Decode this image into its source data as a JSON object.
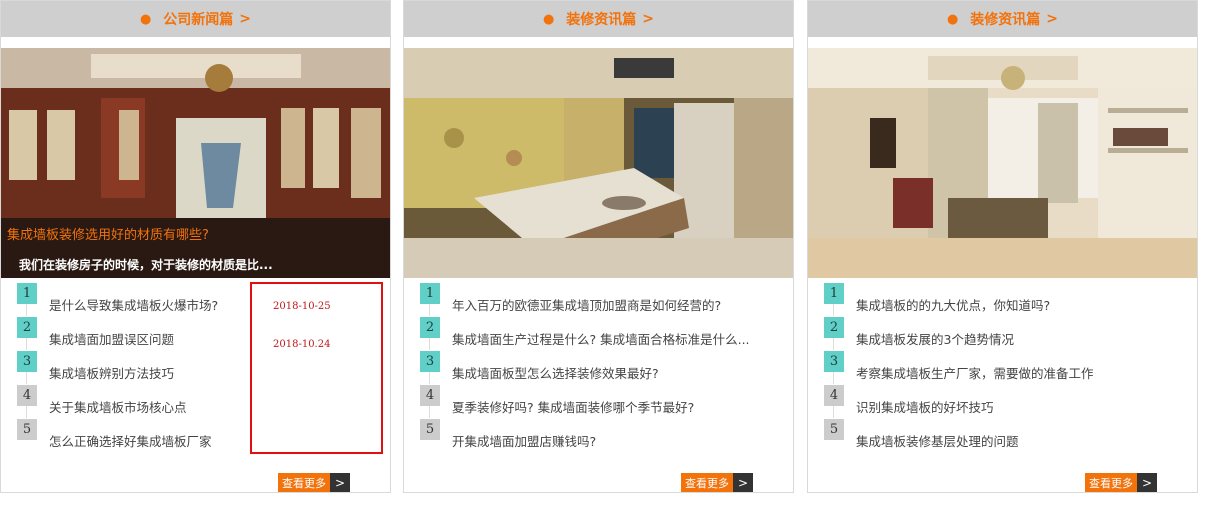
{
  "panels": [
    {
      "header": {
        "dot": "●",
        "title": "公司新闻篇",
        "arrow": ">"
      },
      "hero_title": "集成墙板装修选用好的材质有哪些?",
      "hero_desc": "我们在装修房子的时候，对于装修的材质是比...",
      "items": [
        {
          "num": "1",
          "text": "是什么导致集成墙板火爆市场?"
        },
        {
          "num": "2",
          "text": "集成墙面加盟误区问题"
        },
        {
          "num": "3",
          "text": "集成墙板辨别方法技巧"
        },
        {
          "num": "4",
          "text": "关于集成墙板市场核心点"
        },
        {
          "num": "5",
          "text": "怎么正确选择好集成墙板厂家"
        }
      ],
      "more_label": "查看更多",
      "more_arrow": ">"
    },
    {
      "header": {
        "dot": "●",
        "title": "装修资讯篇",
        "arrow": ">"
      },
      "items": [
        {
          "num": "1",
          "text": "年入百万的欧德亚集成墙顶加盟商是如何经营的?"
        },
        {
          "num": "2",
          "text": "集成墙面生产过程是什么? 集成墙面合格标准是什么..."
        },
        {
          "num": "3",
          "text": "集成墙面板型怎么选择装修效果最好?"
        },
        {
          "num": "4",
          "text": "夏季装修好吗? 集成墙面装修哪个季节最好?"
        },
        {
          "num": "5",
          "text": "开集成墙面加盟店赚钱吗?"
        }
      ],
      "more_label": "查看更多",
      "more_arrow": ">"
    },
    {
      "header": {
        "dot": "●",
        "title": "装修资讯篇",
        "arrow": ">"
      },
      "items": [
        {
          "num": "1",
          "text": "集成墙板的的九大优点，你知道吗?"
        },
        {
          "num": "2",
          "text": "集成墙板发展的3个趋势情况"
        },
        {
          "num": "3",
          "text": "考察集成墙板生产厂家，需要做的准备工作"
        },
        {
          "num": "4",
          "text": "识别集成墙板的好坏技巧"
        },
        {
          "num": "5",
          "text": "集成墙板装修基层处理的问题"
        }
      ],
      "more_label": "查看更多",
      "more_arrow": ">"
    }
  ],
  "annotation": {
    "dates": [
      "2018-10-25",
      "2018-10.24"
    ]
  },
  "colors": {
    "accent": "#f2720c",
    "header_bg": "#cfcfcf",
    "num_teal": "#5fcfc7",
    "num_gray": "#cccccc",
    "annotation_red": "#e01010"
  }
}
